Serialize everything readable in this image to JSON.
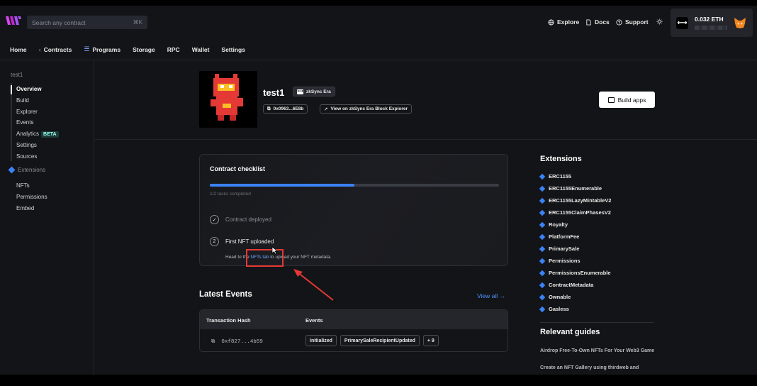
{
  "header": {
    "search_placeholder": "Search any contract",
    "search_shortcut": "⌘K",
    "links": [
      "Explore",
      "Docs",
      "Support"
    ],
    "wallet_balance": "0.032 ETH"
  },
  "nav": {
    "tabs": [
      "Home",
      "Contracts",
      "Programs",
      "Storage",
      "RPC",
      "Wallet",
      "Settings"
    ]
  },
  "sidebar": {
    "title": "test1",
    "items": [
      "Overview",
      "Build",
      "Explorer",
      "Events",
      "Analytics",
      "Settings",
      "Sources"
    ],
    "beta_badge": "BETA",
    "extensions_label": "Extensions",
    "ext_items": [
      "NFTs",
      "Permissions",
      "Embed"
    ]
  },
  "contract": {
    "name": "test1",
    "chain": "zkSync Era",
    "address": "0x0963...6E8b",
    "explorer_link": "View on zkSync Era Block Explorer",
    "build_apps": "Build apps"
  },
  "checklist": {
    "title": "Contract checklist",
    "progress_label": "1/2 tasks completed",
    "progress_fraction": 0.5,
    "step1": "Contract deployed",
    "step2_number": "2",
    "step2": "First NFT uploaded",
    "desc_before": "Head to the ",
    "desc_link": "NFTs tab",
    "desc_after": " to upload your NFT metadata."
  },
  "events": {
    "title": "Latest Events",
    "view_all": "View all →",
    "col_hash": "Transaction Hash",
    "col_events": "Events",
    "row_hash": "0xf827...4b59",
    "tags": [
      "Initialized",
      "PrimarySaleRecipientUpdated",
      "+ 9"
    ]
  },
  "extensions": {
    "title": "Extensions",
    "items": [
      "ERC1155",
      "ERC1155Enumerable",
      "ERC1155LazyMintableV2",
      "ERC1155ClaimPhasesV2",
      "Royalty",
      "PlatformFee",
      "PrimarySale",
      "Permissions",
      "PermissionsEnumerable",
      "ContractMetadata",
      "Ownable",
      "Gasless"
    ]
  },
  "guides": {
    "title": "Relevant guides",
    "items": [
      "Airdrop Free-To-Own NFTs For Your Web3 Game",
      "Create an NFT Gallery using thirdweb and"
    ]
  },
  "colors": {
    "accent": "#3b82f6",
    "link": "#4f93ff",
    "annotation": "#e53935"
  }
}
